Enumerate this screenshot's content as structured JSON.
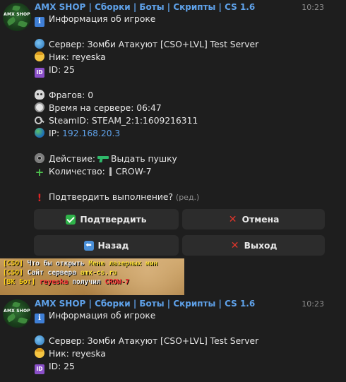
{
  "messages": [
    {
      "author": "AMX SHOP | Сборки | Боты | Скрипты | CS 1.6",
      "time": "10:23",
      "avatar_text": "AMX SHOP",
      "title": "Информация об игроке",
      "server": "Сервер: Зомби Атакуют [CSO+LVL] Test Server",
      "nick": "Ник: reyeska",
      "id": "ID: 25",
      "frags": "Фрагов: 0",
      "time_on_server": "Время на сервере: 06:47",
      "steamid": "SteamID: STEAM_2:1:1609216311",
      "ip_label": "IP:",
      "ip_value": "192.168.20.3",
      "action_label": "Действие:",
      "action_value": "Выдать пушку",
      "quantity_label": "Количество:",
      "quantity_value": "CROW-7",
      "confirm_question": "Подтвердить выполнение?",
      "edited": "(ред.)"
    },
    {
      "author": "AMX SHOP | Сборки | Боты | Скрипты | CS 1.6",
      "time": "10:23",
      "avatar_text": "AMX SHOP",
      "title": "Информация об игроке",
      "server": "Сервер: Зомби Атакуют [CSO+LVL] Test Server",
      "nick": "Ник: reyeska",
      "id": "ID: 25"
    }
  ],
  "buttons": {
    "confirm": "Подтвердить",
    "cancel": "Отмена",
    "back": "Назад",
    "exit": "Выход"
  },
  "game_chat": {
    "line1": {
      "tag": "[CSO]",
      "text": " Что бы открыть ",
      "highlight": "Меню лазерных мин"
    },
    "line2": {
      "tag": "[CSO]",
      "text": " Сайт сервера ",
      "highlight": "amx-cs.ru"
    },
    "line3": {
      "tag": "[ВК Бот]",
      "player": " reyeska",
      "text": " получил ",
      "item": "CROW-7"
    }
  },
  "colors": {
    "background": "#1e1e1e",
    "link": "#5fa2ea",
    "button": "#2c2c2c"
  }
}
